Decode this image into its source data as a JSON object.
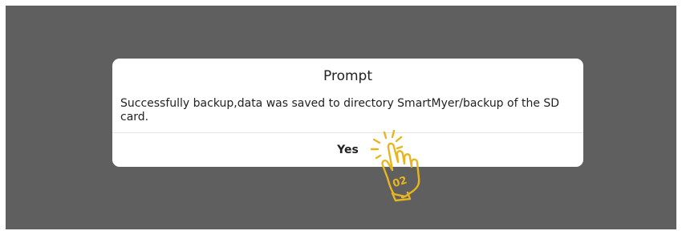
{
  "dialog": {
    "title": "Prompt",
    "message": "Successfully backup,data was saved to directory SmartMyer/backup of the SD card.",
    "yes_label": "Yes"
  },
  "annotation": {
    "step_number": "02",
    "icon": "tap-hand-icon",
    "color": "#e8b520"
  }
}
